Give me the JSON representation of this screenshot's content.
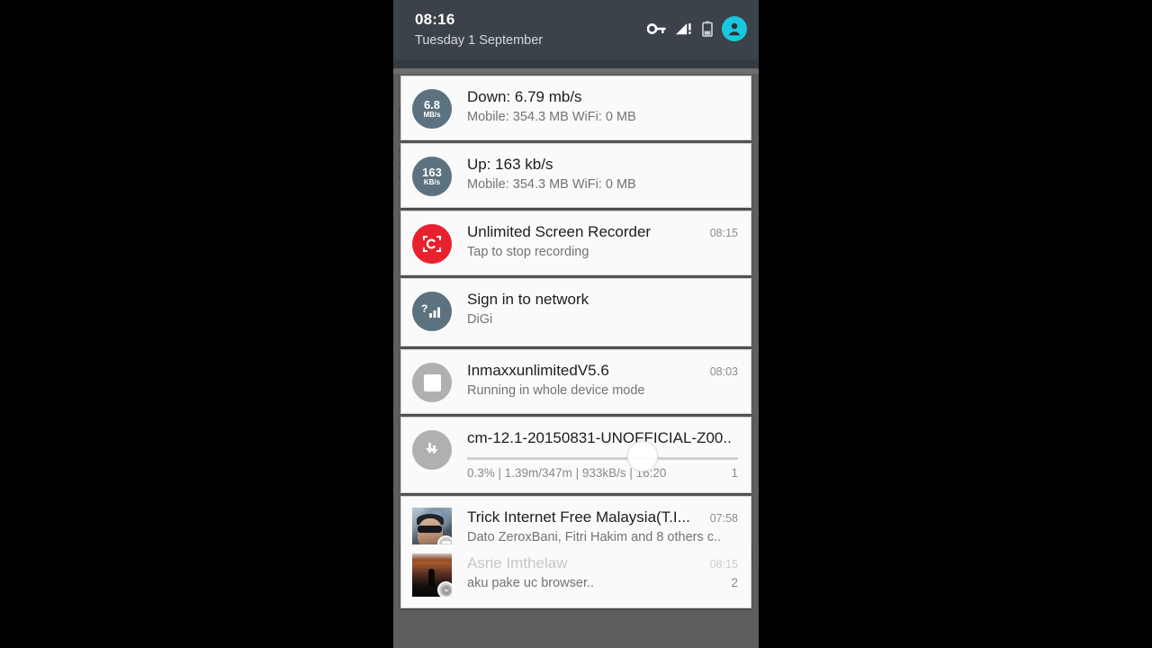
{
  "status_bar": {
    "time": "08:16",
    "date": "Tuesday 1 September",
    "icons": [
      "vpn-key-icon",
      "signal-alert-icon",
      "battery-icon",
      "user-avatar-icon"
    ],
    "accent_color": "#18c8df",
    "background_color": "#3c4249"
  },
  "notifications": [
    {
      "id": "down-speed",
      "icon_name": "network-down-speed-icon",
      "icon_color": "#5c7280",
      "icon_primary": "6.8",
      "icon_secondary": "MB/s",
      "title": "Down: 6.79 mb/s",
      "subtitle": "Mobile: 354.3 MB   WiFi: 0 MB",
      "time": ""
    },
    {
      "id": "up-speed",
      "icon_name": "network-up-speed-icon",
      "icon_color": "#5c7280",
      "icon_primary": "163",
      "icon_secondary": "KB/s",
      "title": "Up: 163 kb/s",
      "subtitle": "Mobile: 354.3 MB   WiFi: 0 MB",
      "time": ""
    },
    {
      "id": "screen-recorder",
      "icon_name": "screen-recorder-icon",
      "icon_color": "#e8212e",
      "title": "Unlimited Screen Recorder",
      "subtitle": "Tap to stop recording",
      "time": "08:15"
    },
    {
      "id": "sign-in-network",
      "icon_name": "wifi-signin-icon",
      "icon_color": "#5c7280",
      "title": "Sign in to network",
      "subtitle": "DiGi",
      "time": ""
    },
    {
      "id": "inmaxx-vpn",
      "icon_name": "stop-service-icon",
      "icon_color": "#b0b0b0",
      "title": "InmaxxunlimitedV5.6",
      "subtitle": "Running in whole device mode",
      "time": "08:03"
    }
  ],
  "download": {
    "id": "download-progress",
    "icon_name": "download-arrow-icon",
    "icon_color": "#b0b0b0",
    "title": "cm-12.1-20150831-UNOFFICIAL-Z00..",
    "percent_label": "0.3%",
    "size_label": "1.39m/347m",
    "speed_label": "933kB/s",
    "eta_label": "16:20",
    "stats_line": "0.3%  |  1.39m/347m  |  933kB/s  |  16:20",
    "count": "1",
    "progress_percent": 0.3,
    "touch_indicator": true
  },
  "social": [
    {
      "id": "facebook-group",
      "icon_name": "facebook-group-avatar",
      "badge_name": "group-badge-icon",
      "title": "Trick Internet Free Malaysia(T.I...",
      "subtitle": "Dato ZeroxBani, Fitri Hakim and 8 others c..",
      "time": "07:58",
      "count": ""
    },
    {
      "id": "messenger-chat",
      "icon_name": "messenger-avatar",
      "badge_name": "messenger-badge-icon",
      "title": "Asrie Imthelaw",
      "subtitle": "aku pake uc browser..",
      "time": "08:15",
      "count": "2",
      "obscured": true
    }
  ],
  "colors": {
    "scrim": "#5e5e5e",
    "card": "#fafafa",
    "title_text": "#1d1d1d",
    "sub_text": "#737373",
    "time_text": "#8c8c8c"
  }
}
